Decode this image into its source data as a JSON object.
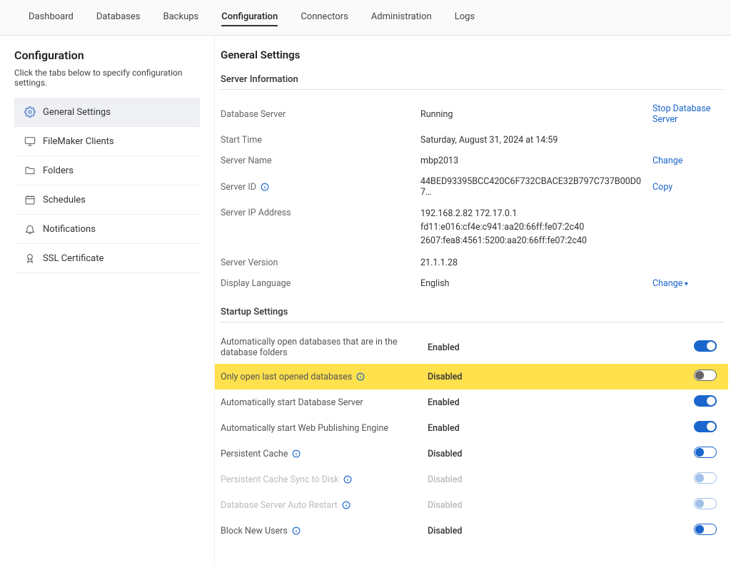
{
  "topnav": {
    "items": [
      "Dashboard",
      "Databases",
      "Backups",
      "Configuration",
      "Connectors",
      "Administration",
      "Logs"
    ],
    "active": "Configuration"
  },
  "sidebar": {
    "title": "Configuration",
    "hint": "Click the tabs below to specify configuration settings.",
    "items": [
      {
        "label": "General Settings",
        "icon": "gear",
        "active": true
      },
      {
        "label": "FileMaker Clients",
        "icon": "monitor",
        "active": false
      },
      {
        "label": "Folders",
        "icon": "folder",
        "active": false
      },
      {
        "label": "Schedules",
        "icon": "calendar",
        "active": false
      },
      {
        "label": "Notifications",
        "icon": "bell",
        "active": false
      },
      {
        "label": "SSL Certificate",
        "icon": "certificate",
        "active": false
      }
    ]
  },
  "main": {
    "title": "General Settings",
    "server_info": {
      "heading": "Server Information",
      "rows": {
        "db_server": {
          "label": "Database Server",
          "value": "Running",
          "action": "Stop Database Server"
        },
        "start_time": {
          "label": "Start Time",
          "value": "Saturday, August 31, 2024 at 14:59"
        },
        "server_name": {
          "label": "Server Name",
          "value": "mbp2013",
          "action": "Change"
        },
        "server_id": {
          "label": "Server ID",
          "value": "44BED93395BCC420C6F732CBACE32B797C737B00D07…",
          "action": "Copy",
          "info": true
        },
        "server_ip": {
          "label": "Server IP Address",
          "value1": "192.168.2.82 172.17.0.1",
          "value2": "fd11:e016:cf4e:c941:aa20:66ff:fe07:2c40",
          "value3": "2607:fea8:4561:5200:aa20:66ff:fe07:2c40"
        },
        "version": {
          "label": "Server Version",
          "value": "21.1.1.28"
        },
        "lang": {
          "label": "Display Language",
          "value": "English",
          "action": "Change",
          "action_chevron": true
        }
      }
    },
    "startup": {
      "heading": "Startup Settings",
      "rows": [
        {
          "key": "auto_open_db",
          "label": "Automatically open databases that are in the database folders",
          "value": "Enabled",
          "toggle": "on"
        },
        {
          "key": "only_last",
          "label": "Only open last opened databases",
          "value": "Disabled",
          "toggle": "dark-off",
          "info": true,
          "highlight": true
        },
        {
          "key": "auto_start_db",
          "label": "Automatically start Database Server",
          "value": "Enabled",
          "toggle": "on"
        },
        {
          "key": "auto_start_wpe",
          "label": "Automatically start Web Publishing Engine",
          "value": "Enabled",
          "toggle": "on"
        },
        {
          "key": "persistent_cache",
          "label": "Persistent Cache",
          "value": "Disabled",
          "toggle": "off-outline",
          "info": true
        },
        {
          "key": "pc_sync",
          "label": "Persistent Cache Sync to Disk",
          "value": "Disabled",
          "toggle": "off-dim",
          "info": true,
          "disabled": true
        },
        {
          "key": "auto_restart",
          "label": "Database Server Auto Restart",
          "value": "Disabled",
          "toggle": "off-dim",
          "info": true,
          "disabled": true
        },
        {
          "key": "block_new",
          "label": "Block New Users",
          "value": "Disabled",
          "toggle": "off-outline",
          "info": true
        }
      ]
    }
  }
}
